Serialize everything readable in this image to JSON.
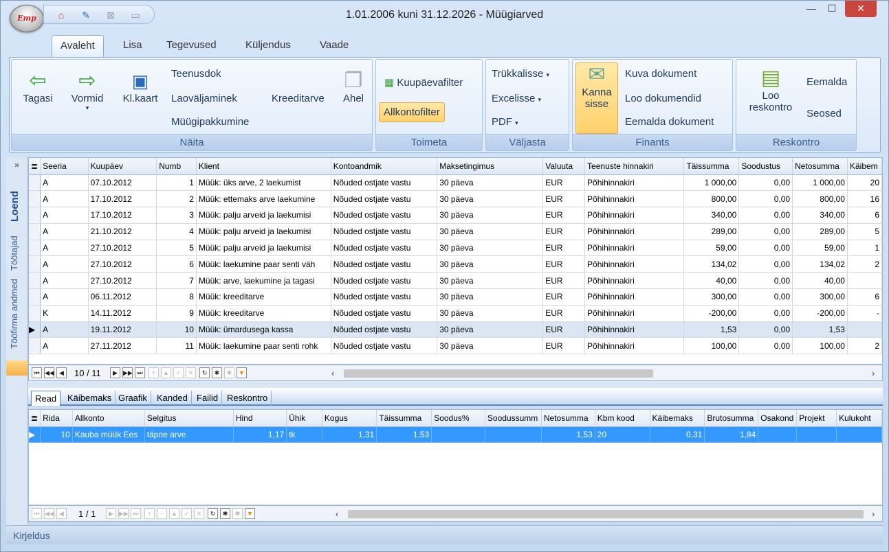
{
  "window": {
    "title": "1.01.2006 kuni 31.12.2026 - Müügiarved",
    "logo": "Emp",
    "controls": [
      "minimize-icon",
      "maximize-icon",
      "close-icon"
    ]
  },
  "qat": [
    "home-icon",
    "edit-icon",
    "close-doc-icon",
    "save-icon"
  ],
  "tabs": [
    "Avaleht",
    "Lisa",
    "Tegevused",
    "Küljendus",
    "Vaade"
  ],
  "ribbon": {
    "naita": {
      "label": "Näita",
      "tagasi": "Tagasi",
      "vormid": "Vormid",
      "klkaart": "Kl.kaart",
      "teenusdok": "Teenusdok",
      "laovaljaminek": "Laoväljaminek",
      "myygipakkumine": "Müügipakkumine",
      "kreeditarve": "Kreeditarve",
      "ahel": "Ahel"
    },
    "toimeta": {
      "label": "Toimeta",
      "kuupaevafilter": "Kuupäevafilter",
      "allkontofilter": "Allkontofilter"
    },
    "valjasta": {
      "label": "Väljasta",
      "trykkalisse": "Trükkalisse",
      "excelisse": "Excelisse",
      "pdf": "PDF"
    },
    "finants": {
      "label": "Finants",
      "kanna1": "Kanna",
      "kanna2": "sisse",
      "kuva": "Kuva dokument",
      "loo": "Loo dokumendid",
      "eemalda": "Eemalda dokument"
    },
    "reskontro": {
      "label": "Reskontro",
      "loo1": "Loo",
      "loo2": "reskontro",
      "eemalda": "Eemalda",
      "seosed": "Seosed"
    }
  },
  "leftbar": {
    "loend": "Loend",
    "tootajad": "Töötajad",
    "toofirma": "Tööfirma andmed"
  },
  "grid1": {
    "columns": [
      "Seeria",
      "Kuupäev",
      "Numb",
      "Klient",
      "Kontoandmik",
      "Maksetingimus",
      "Valuuta",
      "Teenuste hinnakiri",
      "Täissumma",
      "Soodustus",
      "Netosumma",
      "Käibem"
    ],
    "rows": [
      [
        "A",
        "07.10.2012",
        "1",
        "Müük: üks arve, 2 laekumist",
        "Nõuded ostjate vastu",
        "30 päeva",
        "EUR",
        "Põhihinnakiri",
        "1 000,00",
        "0,00",
        "1 000,00",
        "20"
      ],
      [
        "A",
        "17.10.2012",
        "2",
        "Müük: ettemaks arve laekumine",
        "Nõuded ostjate vastu",
        "30 päeva",
        "EUR",
        "Põhihinnakiri",
        "800,00",
        "0,00",
        "800,00",
        "16"
      ],
      [
        "A",
        "17.10.2012",
        "3",
        "Müük: palju arveid ja laekumisi",
        "Nõuded ostjate vastu",
        "30 päeva",
        "EUR",
        "Põhihinnakiri",
        "340,00",
        "0,00",
        "340,00",
        "6"
      ],
      [
        "A",
        "21.10.2012",
        "4",
        "Müük: palju arveid ja laekumisi",
        "Nõuded ostjate vastu",
        "30 päeva",
        "EUR",
        "Põhihinnakiri",
        "289,00",
        "0,00",
        "289,00",
        "5"
      ],
      [
        "A",
        "27.10.2012",
        "5",
        "Müük: palju arveid ja laekumisi",
        "Nõuded ostjate vastu",
        "30 päeva",
        "EUR",
        "Põhihinnakiri",
        "59,00",
        "0,00",
        "59,00",
        "1"
      ],
      [
        "A",
        "27.10.2012",
        "6",
        "Müük: laekumine paar senti väh",
        "Nõuded ostjate vastu",
        "30 päeva",
        "EUR",
        "Põhihinnakiri",
        "134,02",
        "0,00",
        "134,02",
        "2"
      ],
      [
        "A",
        "27.10.2012",
        "7",
        "Müük: arve, laekumine ja tagasi",
        "Nõuded ostjate vastu",
        "30 päeva",
        "EUR",
        "Põhihinnakiri",
        "40,00",
        "0,00",
        "40,00",
        ""
      ],
      [
        "A",
        "06.11.2012",
        "8",
        "Müük: kreeditarve",
        "Nõuded ostjate vastu",
        "30 päeva",
        "EUR",
        "Põhihinnakiri",
        "300,00",
        "0,00",
        "300,00",
        "6"
      ],
      [
        "K",
        "14.11.2012",
        "9",
        "Müük: kreeditarve",
        "Nõuded ostjate vastu",
        "30 päeva",
        "EUR",
        "Põhihinnakiri",
        "-200,00",
        "0,00",
        "-200,00",
        "-"
      ],
      [
        "A",
        "19.11.2012",
        "10",
        "Müük: ümardusega kassa",
        "Nõuded ostjate vastu",
        "30 päeva",
        "EUR",
        "Põhihinnakiri",
        "1,53",
        "0,00",
        "1,53",
        ""
      ],
      [
        "A",
        "27.11.2012",
        "11",
        "Müük: laekumine paar senti rohk",
        "Nõuded ostjate vastu",
        "30 päeva",
        "EUR",
        "Põhihinnakiri",
        "100,00",
        "0,00",
        "100,00",
        "2"
      ]
    ],
    "selected_row": 9,
    "nav": "10 / 11"
  },
  "tabs2": [
    "Read",
    "Käibemaks",
    "Graafik",
    "Kanded",
    "Failid",
    "Reskontro"
  ],
  "grid2": {
    "columns": [
      "Rida",
      "Allkonto",
      "Selgitus",
      "Hind",
      "Ühik",
      "Kogus",
      "Täissumma",
      "Soodus%",
      "Soodussumm",
      "Netosumma",
      "Kbm kood",
      "Käibemaks",
      "Brutosumma",
      "Osakond",
      "Projekt",
      "Kulukoht"
    ],
    "row": [
      "10",
      "Kauba müük Ees",
      "täpne arve",
      "1,17",
      "tk",
      "1,31",
      "1,53",
      "",
      "",
      "1,53",
      "20",
      "0,31",
      "1,84",
      "",
      "",
      ""
    ],
    "nav": "1 / 1"
  },
  "status": "Kirjeldus"
}
